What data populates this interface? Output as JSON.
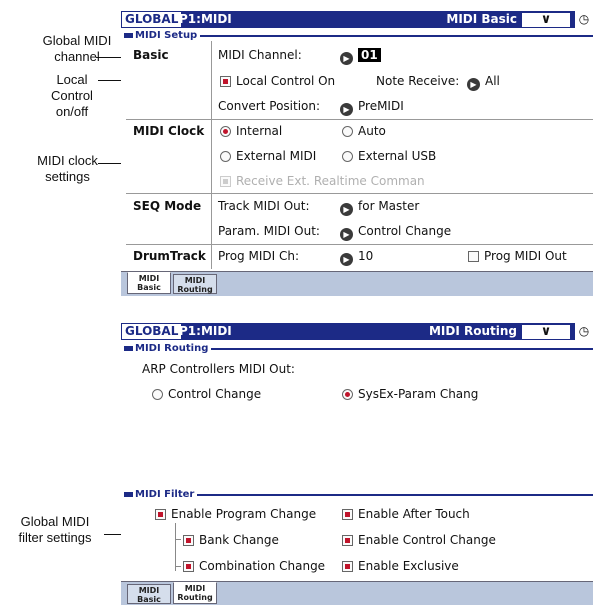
{
  "callouts": {
    "global_midi_channel": [
      "Global MIDI",
      "channel"
    ],
    "local_control": [
      "Local",
      "Control",
      "on/off"
    ],
    "midi_clock": [
      "MIDI clock",
      "settings"
    ],
    "filter": [
      "Global MIDI",
      "filter settings"
    ]
  },
  "basic": {
    "title": {
      "global": "GLOBAL",
      "page": "P1:MIDI",
      "name": "MIDI Basic",
      "dropdown": "∨",
      "clock": "◷"
    },
    "setup_label": "MIDI Setup",
    "basic_label": "Basic",
    "midi_channel_label": "MIDI Channel:",
    "midi_channel_value": "01",
    "local_control": "Local Control On",
    "note_receive_label": "Note Receive:",
    "note_receive_value": "All",
    "convert_position_label": "Convert Position:",
    "convert_position_value": "PreMIDI",
    "midi_clock_label": "MIDI Clock",
    "clock_options": {
      "internal": "Internal",
      "auto": "Auto",
      "external_midi": "External MIDI",
      "external_usb": "External USB"
    },
    "clock_selected": "internal",
    "receive_ext": "Receive Ext. Realtime Comman",
    "seq_mode_label": "SEQ Mode",
    "track_midi_out_label": "Track MIDI Out:",
    "track_midi_out_value": "for Master",
    "param_midi_out_label": "Param. MIDI Out:",
    "param_midi_out_value": "Control Change",
    "drumtrack_label": "DrumTrack",
    "prog_midi_ch_label": "Prog MIDI Ch:",
    "prog_midi_ch_value": "10",
    "prog_midi_out": "Prog MIDI Out",
    "tabs": [
      {
        "l1": "MIDI",
        "l2": "Basic"
      },
      {
        "l1": "MIDI",
        "l2": "Routing"
      }
    ]
  },
  "routing": {
    "title": {
      "global": "GLOBAL",
      "page": "P1:MIDI",
      "name": "MIDI Routing",
      "dropdown": "∨",
      "clock": "◷"
    },
    "routing_label": "MIDI Routing",
    "arp_label": "ARP Controllers MIDI Out:",
    "control_change": "Control Change",
    "sysex": "SysEx-Param Chang",
    "filter_label": "MIDI Filter",
    "enable_program_change": "Enable Program Change",
    "bank_change": "Bank Change",
    "combination_change": "Combination Change",
    "enable_after_touch": "Enable After Touch",
    "enable_control_change": "Enable Control Change",
    "enable_exclusive": "Enable Exclusive",
    "tabs": [
      {
        "l1": "MIDI",
        "l2": "Basic"
      },
      {
        "l1": "MIDI",
        "l2": "Routing"
      }
    ]
  },
  "colors": {
    "title_bar": "#1c2a86",
    "tab_bar": "#b9c6dc",
    "check_on": "#c0142b"
  }
}
